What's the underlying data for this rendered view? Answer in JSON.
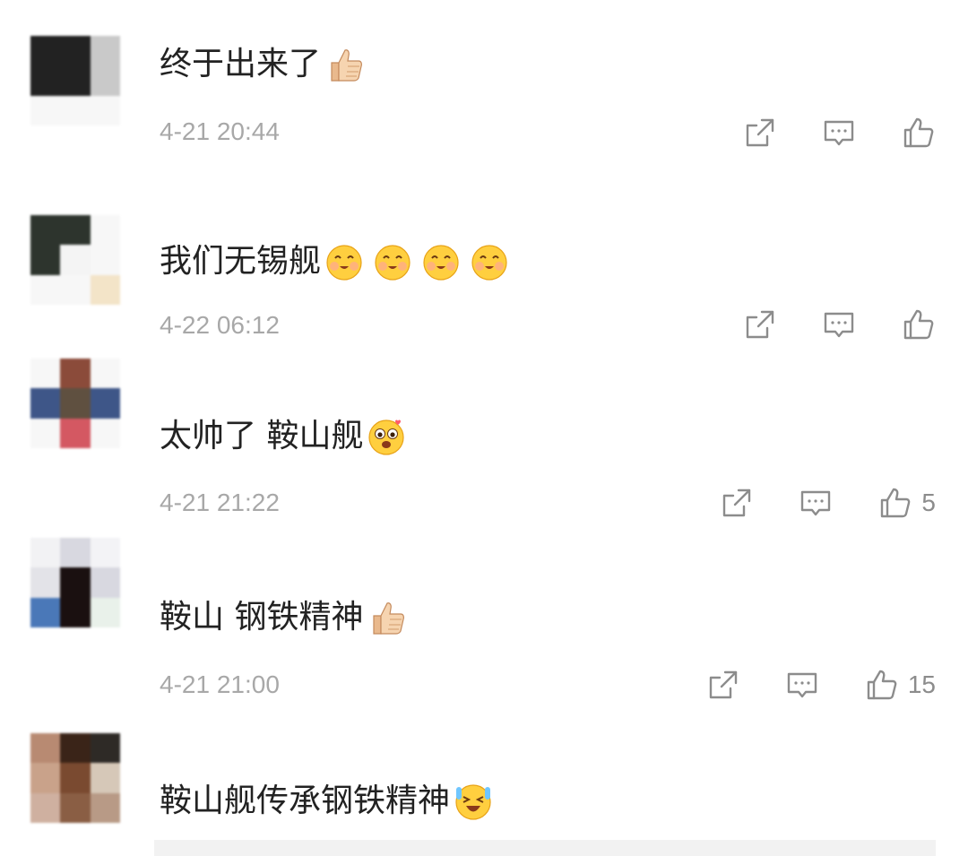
{
  "comments": [
    {
      "text": "终于出来了",
      "emojis": [
        "thumbs-up-emoji"
      ],
      "time": "4-21 20:44",
      "likes": "",
      "avatar_colors": [
        "#222222",
        "#222222",
        "#c9c9c9",
        "#222222",
        "#222222",
        "#c9c9c9",
        "#f7f7f7",
        "#f7f7f7",
        "#f7f7f7"
      ]
    },
    {
      "text": "我们无锡舰",
      "emojis": [
        "blush-smile-emoji",
        "blush-smile-emoji",
        "blush-smile-emoji",
        "blush-smile-emoji"
      ],
      "time": "4-22 06:12",
      "likes": "",
      "avatar_colors": [
        "#2d342d",
        "#2d342d",
        "#f7f7f7",
        "#2d342d",
        "#f4f4f4",
        "#f7f7f7",
        "#f7f7f7",
        "#f7f7f7",
        "#f3e4c8"
      ]
    },
    {
      "text": "太帅了 鞍山舰",
      "emojis": [
        "heart-eyes-cute-emoji"
      ],
      "time": "4-21 21:22",
      "likes": "5",
      "avatar_colors": [
        "#f7f7f7",
        "#8b4b3a",
        "#f7f7f7",
        "#3e5688",
        "#5f5040",
        "#3e5688",
        "#f7f7f7",
        "#d45862",
        "#f7f7f7"
      ]
    },
    {
      "text": "鞍山 钢铁精神",
      "emojis": [
        "thumbs-up-emoji"
      ],
      "time": "4-21 21:00",
      "likes": "15",
      "avatar_colors": [
        "#f2f2f4",
        "#d8d8e0",
        "#f3f3f6",
        "#e3e3e8",
        "#1a1010",
        "#d8d8e0",
        "#4a78b8",
        "#1a1010",
        "#e9f1ea"
      ]
    },
    {
      "text": "鞍山舰传承钢铁精神",
      "emojis": [
        "laugh-cry-emoji"
      ],
      "time": "",
      "likes": "",
      "avatar_colors": [
        "#b88a72",
        "#3a2418",
        "#2e2a26",
        "#c9a28a",
        "#7a4a30",
        "#d6c8b8",
        "#cfb0a0",
        "#8a5e44",
        "#b89a86"
      ]
    }
  ]
}
